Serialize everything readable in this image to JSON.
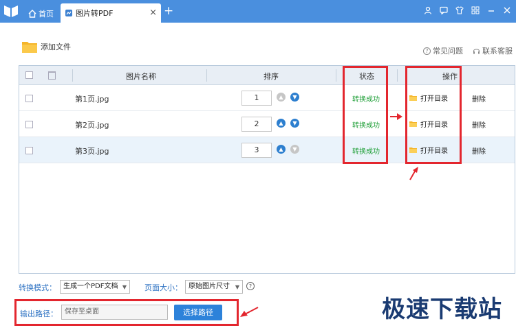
{
  "tabs": {
    "home_label": "首页",
    "active_label": "图片转PDF",
    "close_glyph": "×",
    "add_glyph": "+"
  },
  "window_icons": [
    "user-icon",
    "message-icon",
    "shirt-icon",
    "grid-icon",
    "minimize-icon",
    "close-icon"
  ],
  "toolbar": {
    "add_file_label": "添加文件",
    "faq_label": "常见问题",
    "contact_label": "联系客服"
  },
  "table": {
    "headers": {
      "name": "图片名称",
      "order": "排序",
      "status": "状态",
      "action": "操作"
    },
    "rows": [
      {
        "name": "第1页.jpg",
        "order": "1",
        "status": "转换成功",
        "open_label": "打开目录",
        "delete_label": "删除",
        "up_enabled": false,
        "down_enabled": true
      },
      {
        "name": "第2页.jpg",
        "order": "2",
        "status": "转换成功",
        "open_label": "打开目录",
        "delete_label": "删除",
        "up_enabled": true,
        "down_enabled": true
      },
      {
        "name": "第3页.jpg",
        "order": "3",
        "status": "转换成功",
        "open_label": "打开目录",
        "delete_label": "删除",
        "up_enabled": true,
        "down_enabled": false
      }
    ]
  },
  "options": {
    "mode_label": "转换模式：",
    "mode_value": "生成一个PDF文档",
    "page_size_label": "页面大小：",
    "page_size_value": "原始图片尺寸"
  },
  "output": {
    "label": "输出路径：",
    "value": "保存至桌面",
    "button_label": "选择路径"
  },
  "watermark": "极速下载站",
  "colors": {
    "titlebar": "#4a8fde",
    "accent": "#2d82da",
    "success": "#22a03a",
    "annotation": "#e3262e"
  }
}
